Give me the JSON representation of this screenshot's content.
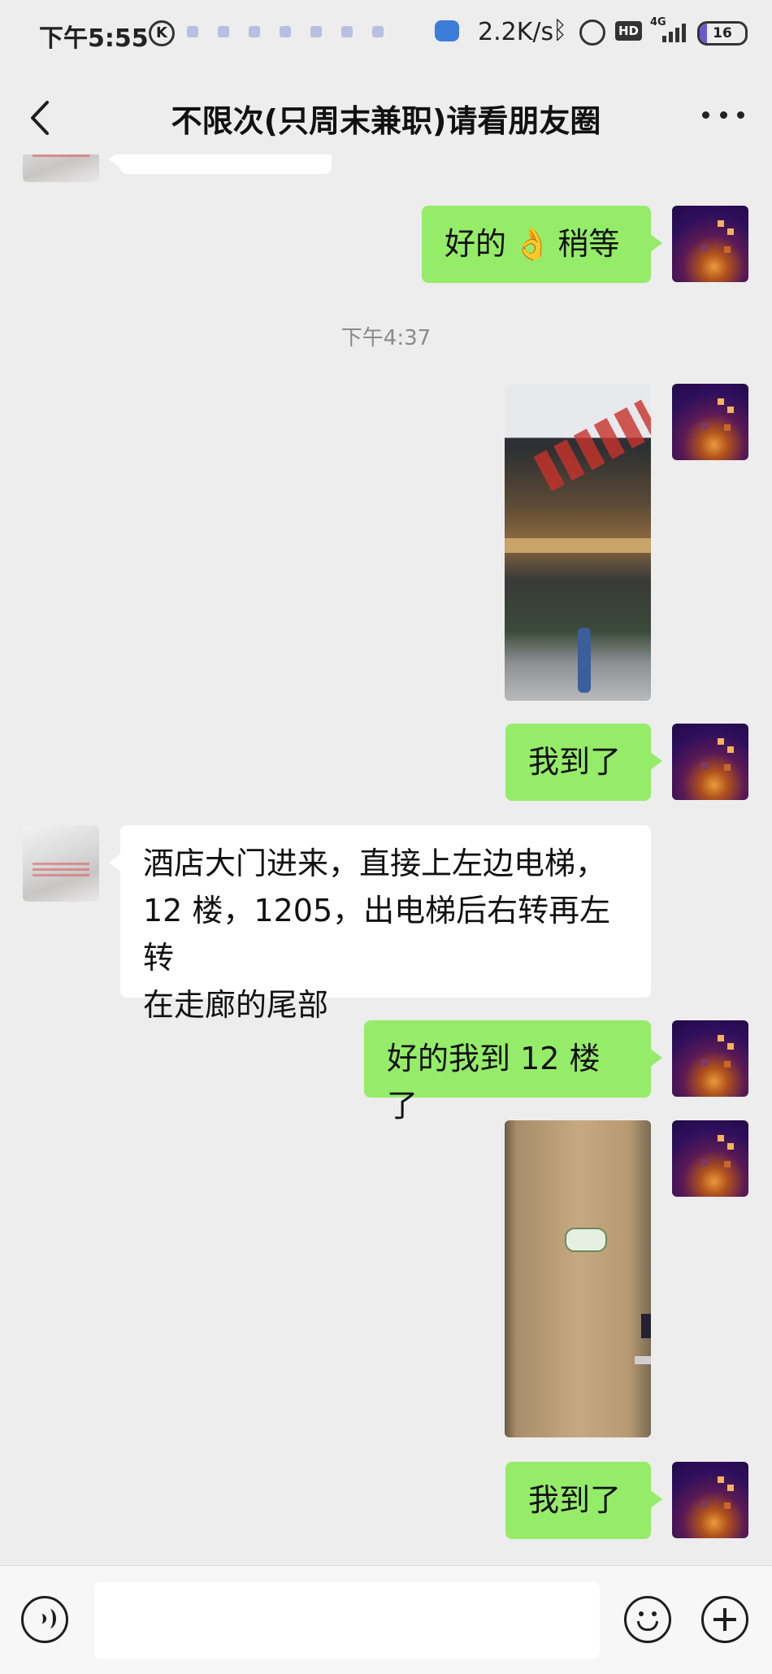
{
  "status_bar": {
    "time": "下午5:55",
    "speed": "2.2K/s",
    "hd": "HD",
    "network": "4G",
    "battery": "16"
  },
  "title_bar": {
    "title": "不限次(只周末兼职)请看朋友圈"
  },
  "messages": {
    "m1_text_a": "好的",
    "m1_emoji": "👌",
    "m1_text_b": "稍等",
    "timestamp": "下午4:37",
    "m3": "我到了",
    "m4_line1": "酒店大门进来，直接上左边电梯，",
    "m4_line2": "12 楼，1205，出电梯后右转再左转",
    "m4_line3": "在走廊的尾部",
    "m5": "好的我到 12 楼了",
    "m7": "我到了"
  },
  "input_bar": {
    "value": "",
    "placeholder": ""
  },
  "colors": {
    "background": "#ededed",
    "bubble_self": "#95ec69",
    "bubble_other": "#ffffff"
  },
  "icons": {
    "back": "chevron-left-icon",
    "more": "more-dots-icon",
    "voice": "voice-icon",
    "emoji": "emoji-icon",
    "plus": "plus-icon"
  }
}
